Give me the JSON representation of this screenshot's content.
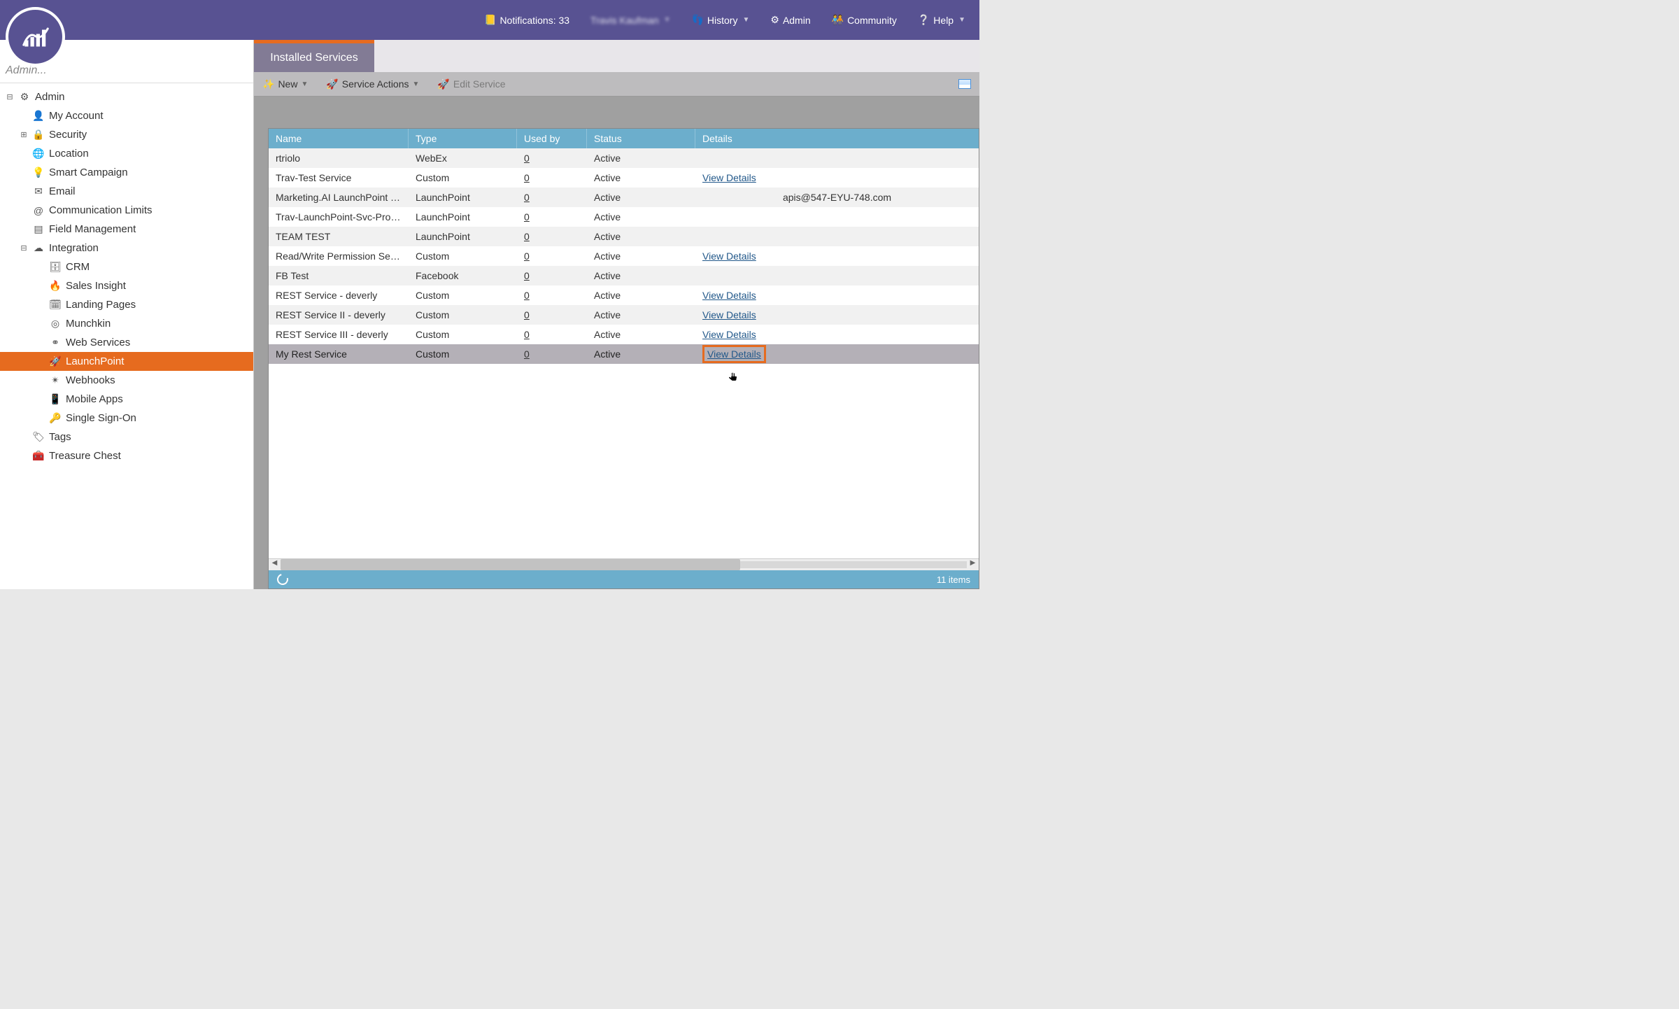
{
  "header": {
    "notifications_label": "Notifications: 33",
    "user_name": "Travis Kaufman",
    "history_label": "History",
    "admin_label": "Admin",
    "community_label": "Community",
    "help_label": "Help"
  },
  "sidebar": {
    "search_placeholder": "Admin...",
    "nodes": [
      {
        "label": "Admin",
        "icon": "⚙",
        "level": 0,
        "toggle": "⊟"
      },
      {
        "label": "My Account",
        "icon": "👤",
        "level": 1
      },
      {
        "label": "Security",
        "icon": "🔒",
        "level": 1,
        "toggle": "⊞"
      },
      {
        "label": "Location",
        "icon": "🌐",
        "level": 1
      },
      {
        "label": "Smart Campaign",
        "icon": "💡",
        "level": 1
      },
      {
        "label": "Email",
        "icon": "✉",
        "level": 1
      },
      {
        "label": "Communication Limits",
        "icon": "@",
        "level": 1
      },
      {
        "label": "Field Management",
        "icon": "▤",
        "level": 1
      },
      {
        "label": "Integration",
        "icon": "☁",
        "level": 1,
        "toggle": "⊟"
      },
      {
        "label": "CRM",
        "icon": "🗄",
        "level": 2
      },
      {
        "label": "Sales Insight",
        "icon": "🔥",
        "level": 2
      },
      {
        "label": "Landing Pages",
        "icon": "🗓",
        "level": 2
      },
      {
        "label": "Munchkin",
        "icon": "◎",
        "level": 2
      },
      {
        "label": "Web Services",
        "icon": "⚭",
        "level": 2
      },
      {
        "label": "LaunchPoint",
        "icon": "🚀",
        "level": 2,
        "active": true
      },
      {
        "label": "Webhooks",
        "icon": "✴",
        "level": 2
      },
      {
        "label": "Mobile Apps",
        "icon": "📱",
        "level": 2
      },
      {
        "label": "Single Sign-On",
        "icon": "🔑",
        "level": 2
      },
      {
        "label": "Tags",
        "icon": "🏷",
        "level": 1
      },
      {
        "label": "Treasure Chest",
        "icon": "🧰",
        "level": 1
      }
    ]
  },
  "main": {
    "tab_label": "Installed Services",
    "toolbar": {
      "new_label": "New",
      "service_actions_label": "Service Actions",
      "edit_service_label": "Edit Service"
    },
    "columns": {
      "name": "Name",
      "type": "Type",
      "used_by": "Used by",
      "status": "Status",
      "details": "Details"
    },
    "rows": [
      {
        "name": "rtriolo",
        "type": "WebEx",
        "used": "0",
        "status": "Active",
        "details": ""
      },
      {
        "name": "Trav-Test Service",
        "type": "Custom",
        "used": "0",
        "status": "Active",
        "details": "View Details",
        "link": true
      },
      {
        "name": "Marketing.AI LaunchPoint Te...",
        "type": "LaunchPoint",
        "used": "0",
        "status": "Active",
        "details": "apis@547-EYU-748.com"
      },
      {
        "name": "Trav-LaunchPoint-Svc-Prog-I...",
        "type": "LaunchPoint",
        "used": "0",
        "status": "Active",
        "details": ""
      },
      {
        "name": "TEAM TEST",
        "type": "LaunchPoint",
        "used": "0",
        "status": "Active",
        "details": ""
      },
      {
        "name": "Read/Write Permission Servi...",
        "type": "Custom",
        "used": "0",
        "status": "Active",
        "details": "View Details",
        "link": true
      },
      {
        "name": "FB Test",
        "type": "Facebook",
        "used": "0",
        "status": "Active",
        "details": ""
      },
      {
        "name": "REST Service - deverly",
        "type": "Custom",
        "used": "0",
        "status": "Active",
        "details": "View Details",
        "link": true
      },
      {
        "name": "REST Service II - deverly",
        "type": "Custom",
        "used": "0",
        "status": "Active",
        "details": "View Details",
        "link": true
      },
      {
        "name": "REST Service III - deverly",
        "type": "Custom",
        "used": "0",
        "status": "Active",
        "details": "View Details",
        "link": true
      },
      {
        "name": "My Rest Service",
        "type": "Custom",
        "used": "0",
        "status": "Active",
        "details": "View Details",
        "link": true,
        "selected": true,
        "highlight": true
      }
    ],
    "footer_count": "11 items"
  }
}
